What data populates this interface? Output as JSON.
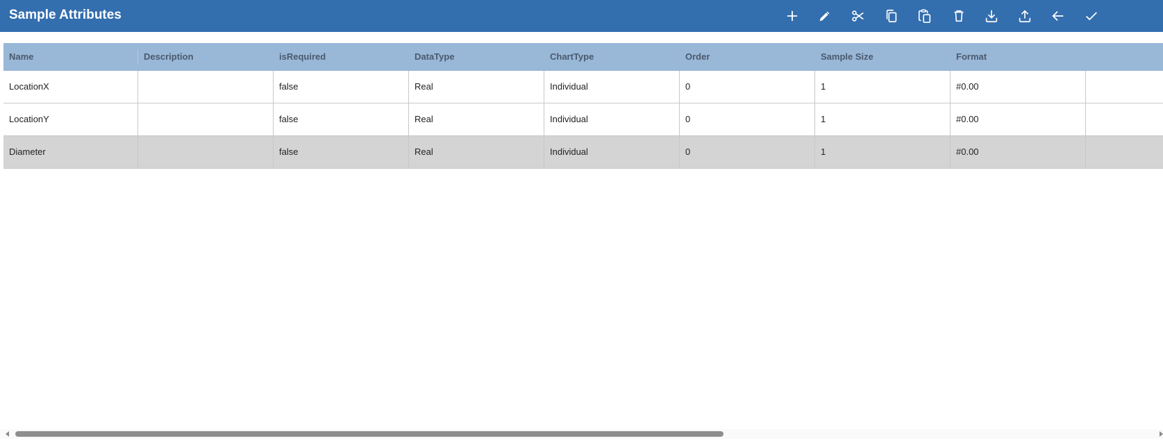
{
  "header": {
    "title": "Sample Attributes",
    "background": "#336eae",
    "toolbar": [
      {
        "name": "add-button",
        "icon": "plus-icon",
        "label": "Add"
      },
      {
        "name": "edit-button",
        "icon": "pencil-icon",
        "label": "Edit"
      },
      {
        "name": "cut-button",
        "icon": "scissors-icon",
        "label": "Cut"
      },
      {
        "name": "copy-button",
        "icon": "copy-icon",
        "label": "Copy"
      },
      {
        "name": "paste-button",
        "icon": "paste-icon",
        "label": "Paste"
      },
      {
        "name": "delete-button",
        "icon": "trash-icon",
        "label": "Delete"
      },
      {
        "name": "download-button",
        "icon": "download-icon",
        "label": "Download"
      },
      {
        "name": "upload-button",
        "icon": "upload-icon",
        "label": "Upload"
      },
      {
        "name": "back-button",
        "icon": "arrow-left-icon",
        "label": "Back"
      },
      {
        "name": "confirm-button",
        "icon": "check-icon",
        "label": "Confirm"
      }
    ]
  },
  "table": {
    "header_color": "#99b7d7",
    "selected_row_color": "#d4d4d4",
    "columns": [
      "Name",
      "Description",
      "isRequired",
      "DataType",
      "ChartType",
      "Order",
      "Sample Size",
      "Format"
    ],
    "rows": [
      {
        "selected": false,
        "cells": [
          "LocationX",
          "",
          "false",
          "Real",
          "Individual",
          "0",
          "1",
          "#0.00"
        ]
      },
      {
        "selected": false,
        "cells": [
          "LocationY",
          "",
          "false",
          "Real",
          "Individual",
          "0",
          "1",
          "#0.00"
        ]
      },
      {
        "selected": true,
        "cells": [
          "Diameter",
          "",
          "false",
          "Real",
          "Individual",
          "0",
          "1",
          "#0.00"
        ]
      }
    ]
  }
}
